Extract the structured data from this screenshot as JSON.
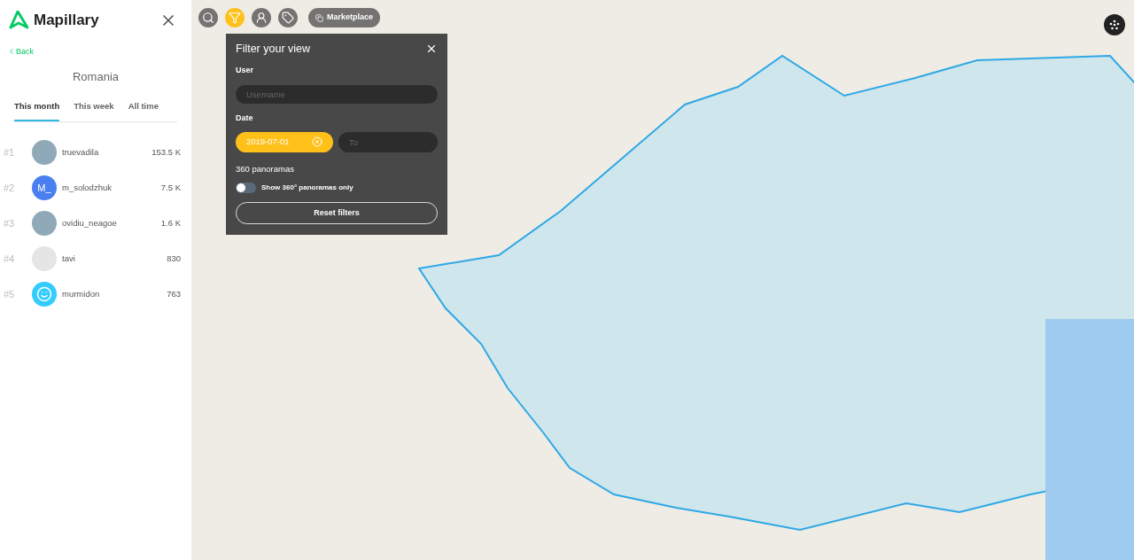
{
  "sidebar": {
    "brand": "Mapillary",
    "back": "Back",
    "region": "Romania",
    "tabs": [
      {
        "label": "This month",
        "selected": true
      },
      {
        "label": "This week",
        "selected": false
      },
      {
        "label": "All time",
        "selected": false
      }
    ],
    "leaders": [
      {
        "rank": "#1",
        "avatar": {
          "kind": "photo"
        },
        "name": "truevadila",
        "count": "153.5 K"
      },
      {
        "rank": "#2",
        "avatar": {
          "kind": "initials",
          "text": "M_",
          "color": "#4a7ff0"
        },
        "name": "m_solodzhuk",
        "count": "7.5 K"
      },
      {
        "rank": "#3",
        "avatar": {
          "kind": "photo"
        },
        "name": "ovidiu_neagoe",
        "count": "1.6 K"
      },
      {
        "rank": "#4",
        "avatar": {
          "kind": "logo"
        },
        "name": "tavi",
        "count": "830"
      },
      {
        "rank": "#5",
        "avatar": {
          "kind": "smiley"
        },
        "name": "murmidon",
        "count": "763"
      }
    ]
  },
  "toolbar": {
    "tools": [
      {
        "kind": "search",
        "selected": false
      },
      {
        "kind": "filter",
        "selected": true
      },
      {
        "kind": "person",
        "selected": false
      },
      {
        "kind": "tag",
        "selected": false
      }
    ],
    "marketplace": "Marketplace"
  },
  "filter_panel": {
    "title": "Filter your view",
    "user_label": "User",
    "user_placeholder": "Username",
    "date_label": "Date",
    "date_from": "2019-07-01",
    "date_to_placeholder": "To",
    "pano_label": "360 panoramas",
    "pano_toggle": {
      "label": "Show 360° panoramas only",
      "on": false
    },
    "reset": "Reset filters"
  }
}
